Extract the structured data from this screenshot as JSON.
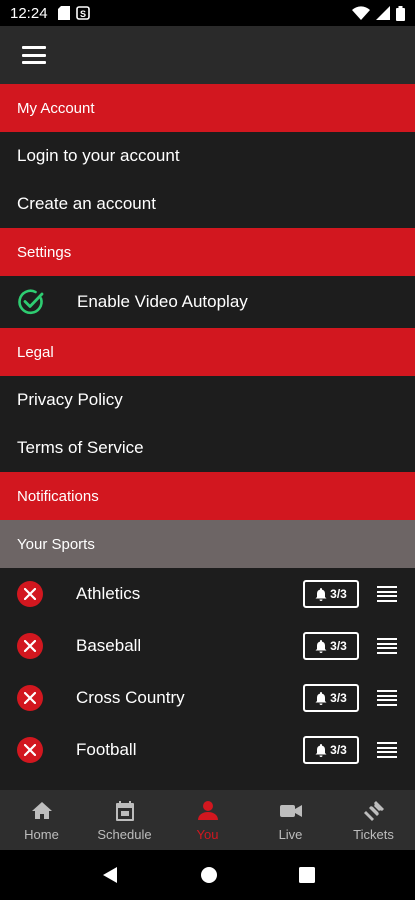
{
  "status_bar": {
    "time": "12:24"
  },
  "sections": {
    "account": {
      "title": "My Account",
      "items": [
        "Login to your account",
        "Create an account"
      ]
    },
    "settings": {
      "title": "Settings",
      "autoplay_label": "Enable Video Autoplay",
      "autoplay_enabled": true
    },
    "legal": {
      "title": "Legal",
      "items": [
        "Privacy Policy",
        "Terms of Service"
      ]
    },
    "notifications": {
      "title": "Notifications",
      "sub_title": "Your Sports"
    }
  },
  "sports": [
    {
      "name": "Athletics",
      "badge": "3/3"
    },
    {
      "name": "Baseball",
      "badge": "3/3"
    },
    {
      "name": "Cross Country",
      "badge": "3/3"
    },
    {
      "name": "Football",
      "badge": "3/3"
    }
  ],
  "bottom_nav": [
    {
      "label": "Home",
      "icon": "home-icon",
      "active": false
    },
    {
      "label": "Schedule",
      "icon": "calendar-icon",
      "active": false
    },
    {
      "label": "You",
      "icon": "person-icon",
      "active": true
    },
    {
      "label": "Live",
      "icon": "video-camera-icon",
      "active": false
    },
    {
      "label": "Tickets",
      "icon": "ticket-icon",
      "active": false
    }
  ],
  "colors": {
    "accent": "#d2171f",
    "background": "#1d1d1d",
    "check": "#2ecc71"
  }
}
